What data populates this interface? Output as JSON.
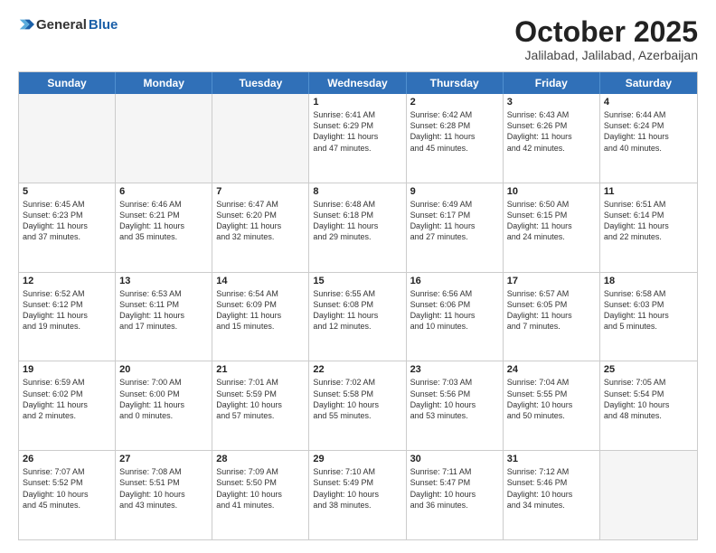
{
  "header": {
    "logo_general": "General",
    "logo_blue": "Blue",
    "month_title": "October 2025",
    "location": "Jalilabad, Jalilabad, Azerbaijan"
  },
  "calendar": {
    "days_of_week": [
      "Sunday",
      "Monday",
      "Tuesday",
      "Wednesday",
      "Thursday",
      "Friday",
      "Saturday"
    ],
    "rows": [
      [
        {
          "day": "",
          "info": ""
        },
        {
          "day": "",
          "info": ""
        },
        {
          "day": "",
          "info": ""
        },
        {
          "day": "1",
          "info": "Sunrise: 6:41 AM\nSunset: 6:29 PM\nDaylight: 11 hours\nand 47 minutes."
        },
        {
          "day": "2",
          "info": "Sunrise: 6:42 AM\nSunset: 6:28 PM\nDaylight: 11 hours\nand 45 minutes."
        },
        {
          "day": "3",
          "info": "Sunrise: 6:43 AM\nSunset: 6:26 PM\nDaylight: 11 hours\nand 42 minutes."
        },
        {
          "day": "4",
          "info": "Sunrise: 6:44 AM\nSunset: 6:24 PM\nDaylight: 11 hours\nand 40 minutes."
        }
      ],
      [
        {
          "day": "5",
          "info": "Sunrise: 6:45 AM\nSunset: 6:23 PM\nDaylight: 11 hours\nand 37 minutes."
        },
        {
          "day": "6",
          "info": "Sunrise: 6:46 AM\nSunset: 6:21 PM\nDaylight: 11 hours\nand 35 minutes."
        },
        {
          "day": "7",
          "info": "Sunrise: 6:47 AM\nSunset: 6:20 PM\nDaylight: 11 hours\nand 32 minutes."
        },
        {
          "day": "8",
          "info": "Sunrise: 6:48 AM\nSunset: 6:18 PM\nDaylight: 11 hours\nand 29 minutes."
        },
        {
          "day": "9",
          "info": "Sunrise: 6:49 AM\nSunset: 6:17 PM\nDaylight: 11 hours\nand 27 minutes."
        },
        {
          "day": "10",
          "info": "Sunrise: 6:50 AM\nSunset: 6:15 PM\nDaylight: 11 hours\nand 24 minutes."
        },
        {
          "day": "11",
          "info": "Sunrise: 6:51 AM\nSunset: 6:14 PM\nDaylight: 11 hours\nand 22 minutes."
        }
      ],
      [
        {
          "day": "12",
          "info": "Sunrise: 6:52 AM\nSunset: 6:12 PM\nDaylight: 11 hours\nand 19 minutes."
        },
        {
          "day": "13",
          "info": "Sunrise: 6:53 AM\nSunset: 6:11 PM\nDaylight: 11 hours\nand 17 minutes."
        },
        {
          "day": "14",
          "info": "Sunrise: 6:54 AM\nSunset: 6:09 PM\nDaylight: 11 hours\nand 15 minutes."
        },
        {
          "day": "15",
          "info": "Sunrise: 6:55 AM\nSunset: 6:08 PM\nDaylight: 11 hours\nand 12 minutes."
        },
        {
          "day": "16",
          "info": "Sunrise: 6:56 AM\nSunset: 6:06 PM\nDaylight: 11 hours\nand 10 minutes."
        },
        {
          "day": "17",
          "info": "Sunrise: 6:57 AM\nSunset: 6:05 PM\nDaylight: 11 hours\nand 7 minutes."
        },
        {
          "day": "18",
          "info": "Sunrise: 6:58 AM\nSunset: 6:03 PM\nDaylight: 11 hours\nand 5 minutes."
        }
      ],
      [
        {
          "day": "19",
          "info": "Sunrise: 6:59 AM\nSunset: 6:02 PM\nDaylight: 11 hours\nand 2 minutes."
        },
        {
          "day": "20",
          "info": "Sunrise: 7:00 AM\nSunset: 6:00 PM\nDaylight: 11 hours\nand 0 minutes."
        },
        {
          "day": "21",
          "info": "Sunrise: 7:01 AM\nSunset: 5:59 PM\nDaylight: 10 hours\nand 57 minutes."
        },
        {
          "day": "22",
          "info": "Sunrise: 7:02 AM\nSunset: 5:58 PM\nDaylight: 10 hours\nand 55 minutes."
        },
        {
          "day": "23",
          "info": "Sunrise: 7:03 AM\nSunset: 5:56 PM\nDaylight: 10 hours\nand 53 minutes."
        },
        {
          "day": "24",
          "info": "Sunrise: 7:04 AM\nSunset: 5:55 PM\nDaylight: 10 hours\nand 50 minutes."
        },
        {
          "day": "25",
          "info": "Sunrise: 7:05 AM\nSunset: 5:54 PM\nDaylight: 10 hours\nand 48 minutes."
        }
      ],
      [
        {
          "day": "26",
          "info": "Sunrise: 7:07 AM\nSunset: 5:52 PM\nDaylight: 10 hours\nand 45 minutes."
        },
        {
          "day": "27",
          "info": "Sunrise: 7:08 AM\nSunset: 5:51 PM\nDaylight: 10 hours\nand 43 minutes."
        },
        {
          "day": "28",
          "info": "Sunrise: 7:09 AM\nSunset: 5:50 PM\nDaylight: 10 hours\nand 41 minutes."
        },
        {
          "day": "29",
          "info": "Sunrise: 7:10 AM\nSunset: 5:49 PM\nDaylight: 10 hours\nand 38 minutes."
        },
        {
          "day": "30",
          "info": "Sunrise: 7:11 AM\nSunset: 5:47 PM\nDaylight: 10 hours\nand 36 minutes."
        },
        {
          "day": "31",
          "info": "Sunrise: 7:12 AM\nSunset: 5:46 PM\nDaylight: 10 hours\nand 34 minutes."
        },
        {
          "day": "",
          "info": ""
        }
      ]
    ]
  }
}
